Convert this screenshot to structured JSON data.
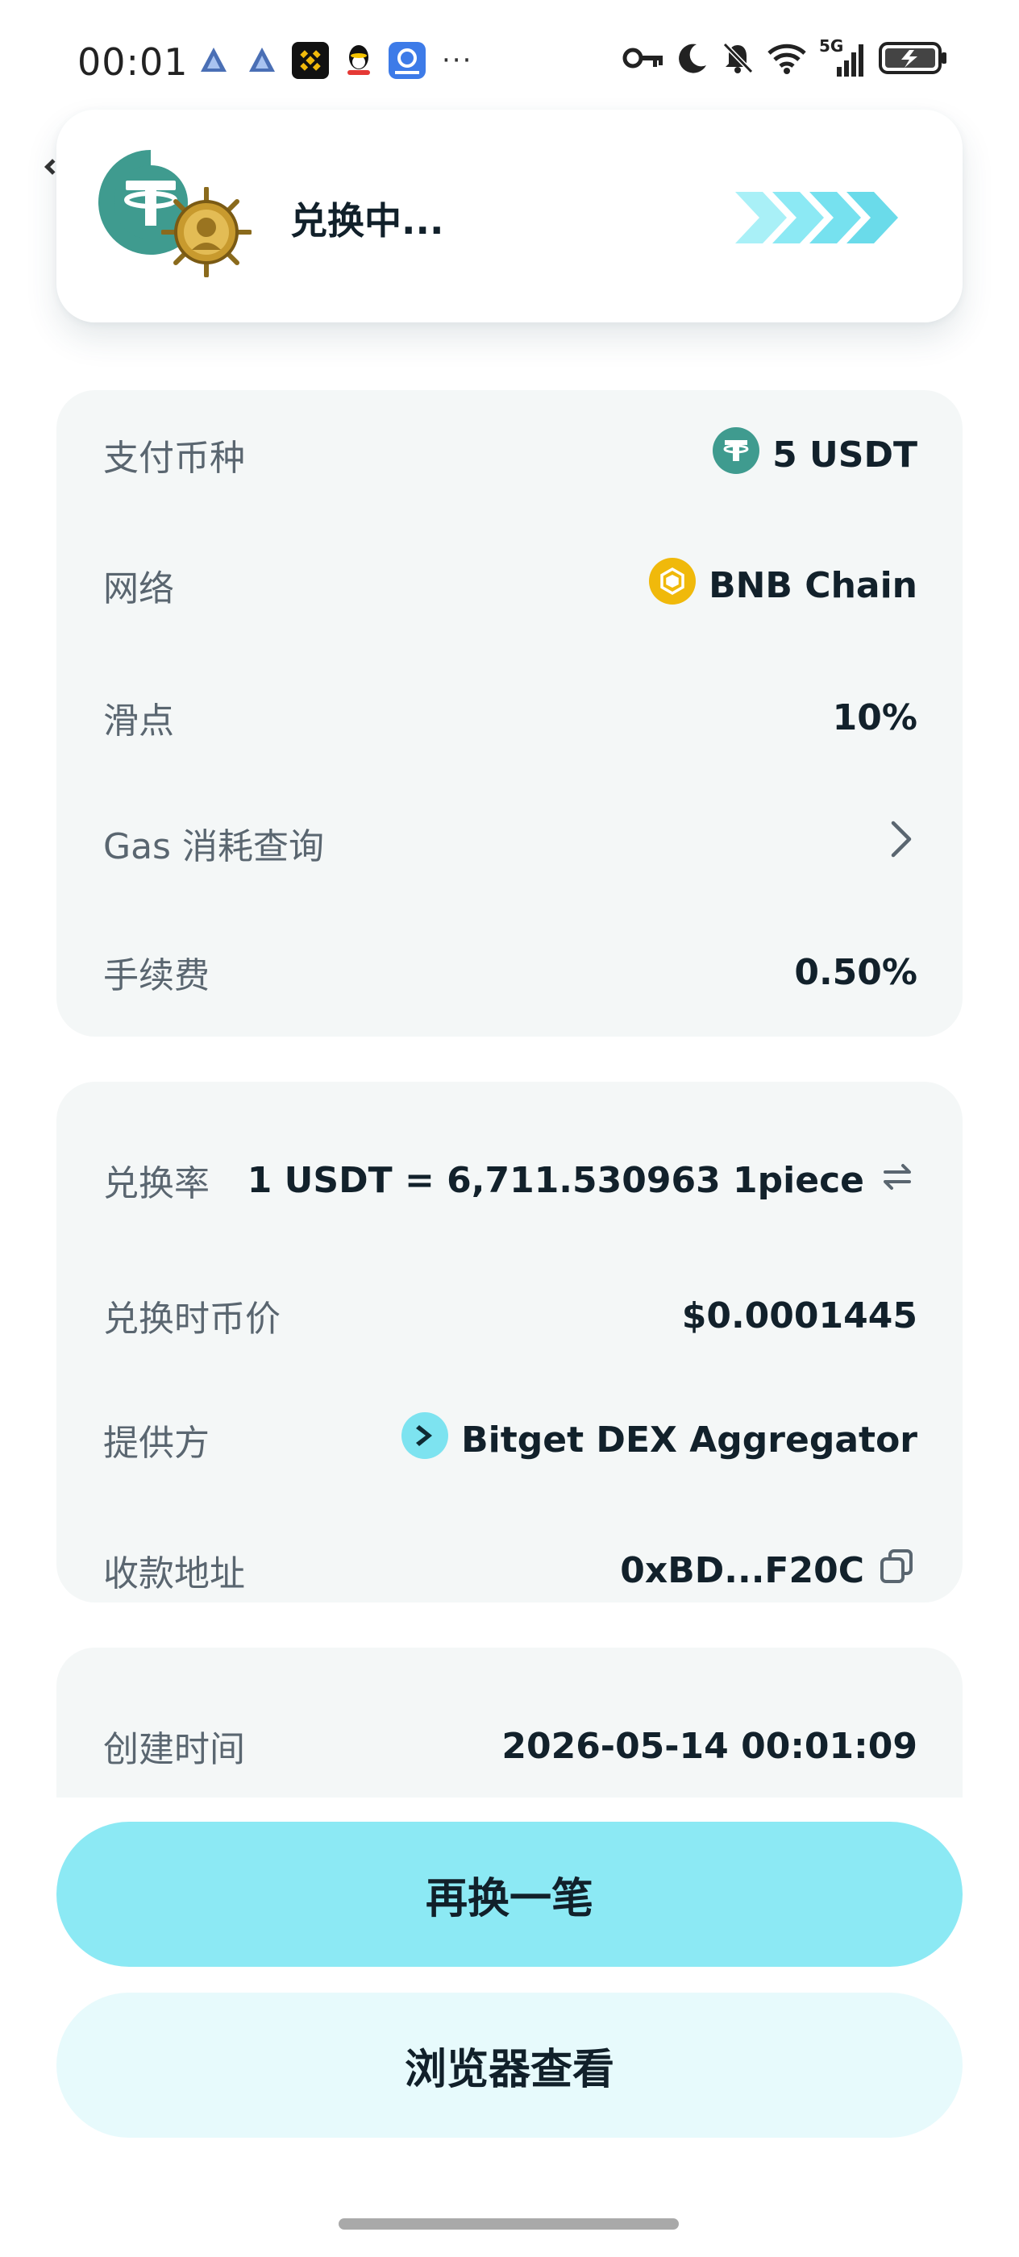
{
  "status_bar": {
    "time": "00:01",
    "more": "···",
    "network": "5G"
  },
  "toast": {
    "title": "兑换中..."
  },
  "payment_card": {
    "pay_coin": {
      "label": "支付币种",
      "value": "5 USDT",
      "icon": "usdt-icon"
    },
    "network": {
      "label": "网络",
      "value": "BNB Chain",
      "icon": "bnb-icon"
    },
    "slippage": {
      "label": "滑点",
      "value": "10%"
    },
    "gas": {
      "label": "Gas 消耗查询",
      "icon": "chevron-right-icon"
    },
    "fee": {
      "label": "手续费",
      "value": "0.50%"
    }
  },
  "rate_card": {
    "rate": {
      "label": "兑换率",
      "value": "1 USDT = 6,711.530963 1piece",
      "icon": "swap-icon"
    },
    "price": {
      "label": "兑换时币价",
      "value": "$0.0001445"
    },
    "provider": {
      "label": "提供方",
      "value": "Bitget DEX Aggregator",
      "icon": "bitget-icon"
    },
    "address": {
      "label": "收款地址",
      "value": "0xBD...F20C",
      "icon": "copy-icon"
    }
  },
  "time_card": {
    "created": {
      "label": "创建时间",
      "value": "2026-05-14 00:01:09"
    }
  },
  "buttons": {
    "swap_again": "再换一笔",
    "view_in_browser": "浏览器查看"
  },
  "colors": {
    "primary_button": "#8ce9f4",
    "secondary_button": "#e7fafc",
    "card_bg": "#f4f7f7",
    "usdt_green": "#3f9b8f",
    "bnb_yellow": "#f0b90b"
  }
}
